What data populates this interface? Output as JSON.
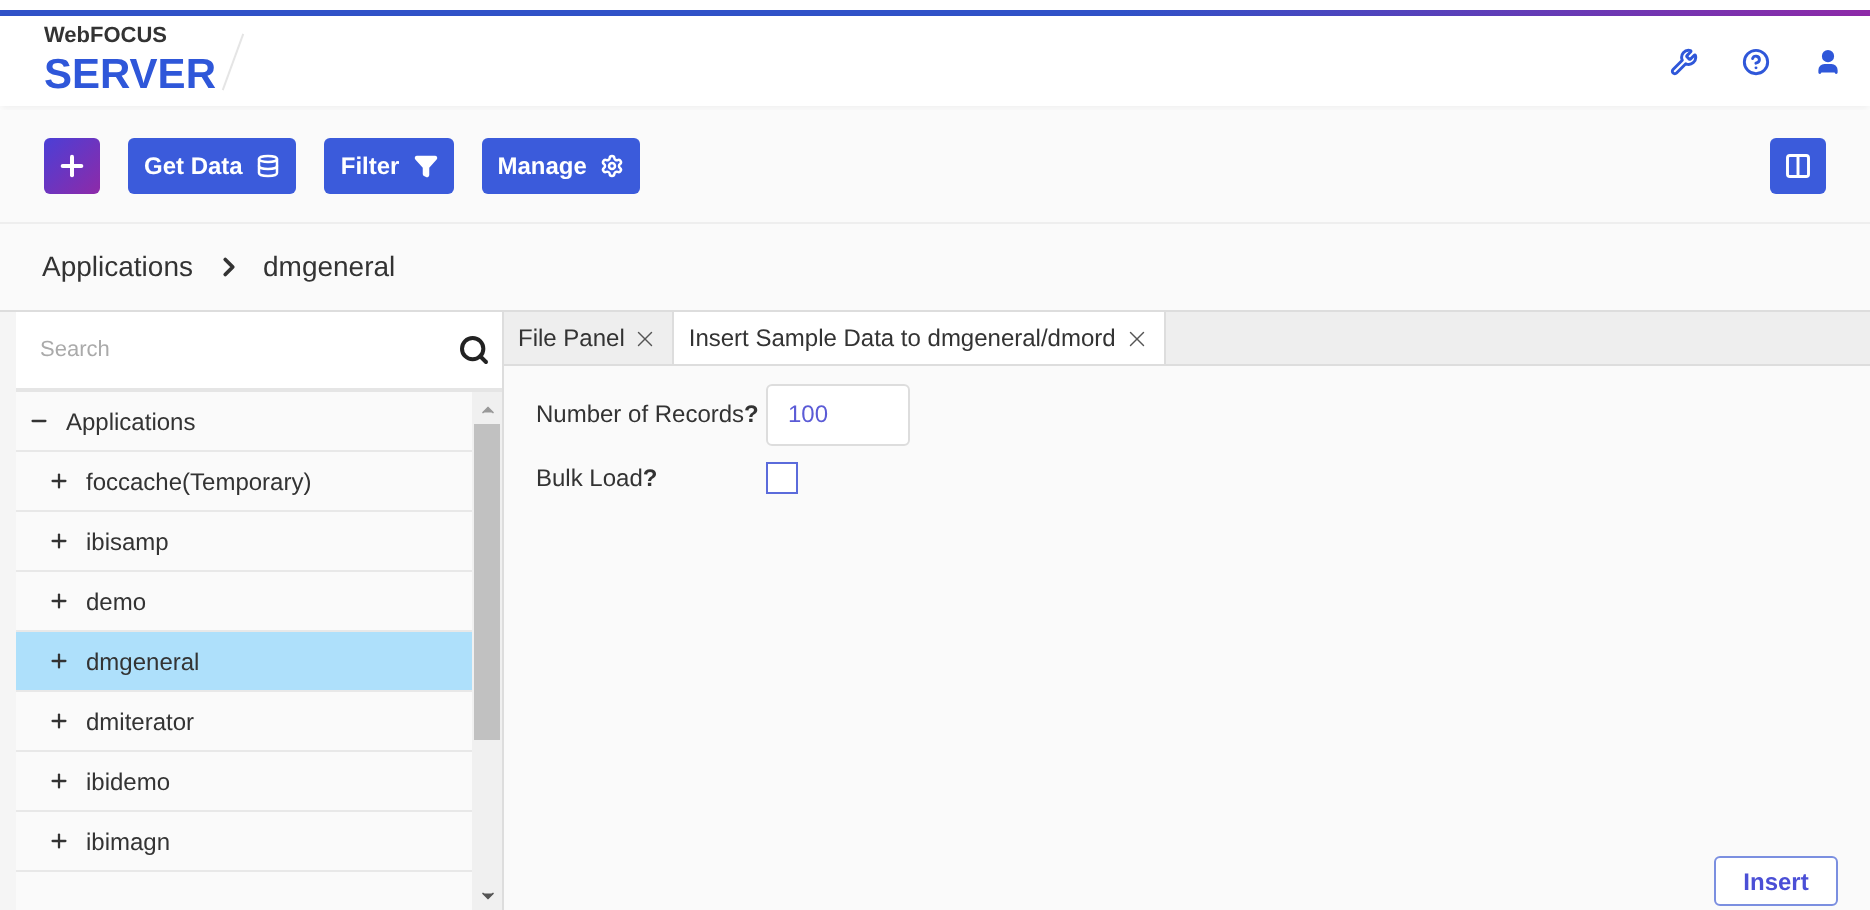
{
  "header": {
    "brand_small": "WebFOCUS",
    "brand_large": "SERVER"
  },
  "toolbar": {
    "buttons": [
      {
        "kind": "add"
      },
      {
        "kind": "text",
        "label": "Get Data"
      },
      {
        "kind": "text",
        "label": "Filter"
      },
      {
        "kind": "text",
        "label": "Manage"
      }
    ]
  },
  "breadcrumb": [
    "Applications",
    "dmgeneral"
  ],
  "sidebar": {
    "search": {
      "placeholder": "Search"
    },
    "tree": [
      {
        "label": "Applications",
        "expanded": true,
        "selected": false,
        "children": [
          {
            "label": "foccache(Temporary)",
            "expanded": false,
            "selected": false
          },
          {
            "label": "ibisamp",
            "expanded": false,
            "selected": false
          },
          {
            "label": "demo",
            "expanded": false,
            "selected": false
          },
          {
            "label": "dmgeneral",
            "expanded": false,
            "selected": true
          },
          {
            "label": "dmiterator",
            "expanded": false,
            "selected": false
          },
          {
            "label": "ibidemo",
            "expanded": false,
            "selected": false
          },
          {
            "label": "ibimagn",
            "expanded": false,
            "selected": false
          }
        ]
      }
    ]
  },
  "tabs": [
    {
      "label": "File Panel",
      "selected": false
    },
    {
      "label": "Insert Sample Data to dmgeneral/dmord",
      "selected": true
    }
  ],
  "form": {
    "fields": [
      {
        "kind": "text",
        "label": "Number of Records",
        "help": "?",
        "value": "100"
      },
      {
        "kind": "checkbox",
        "label": "Bulk Load",
        "help": "?",
        "checked": false
      }
    ]
  },
  "insert_button": "Insert"
}
